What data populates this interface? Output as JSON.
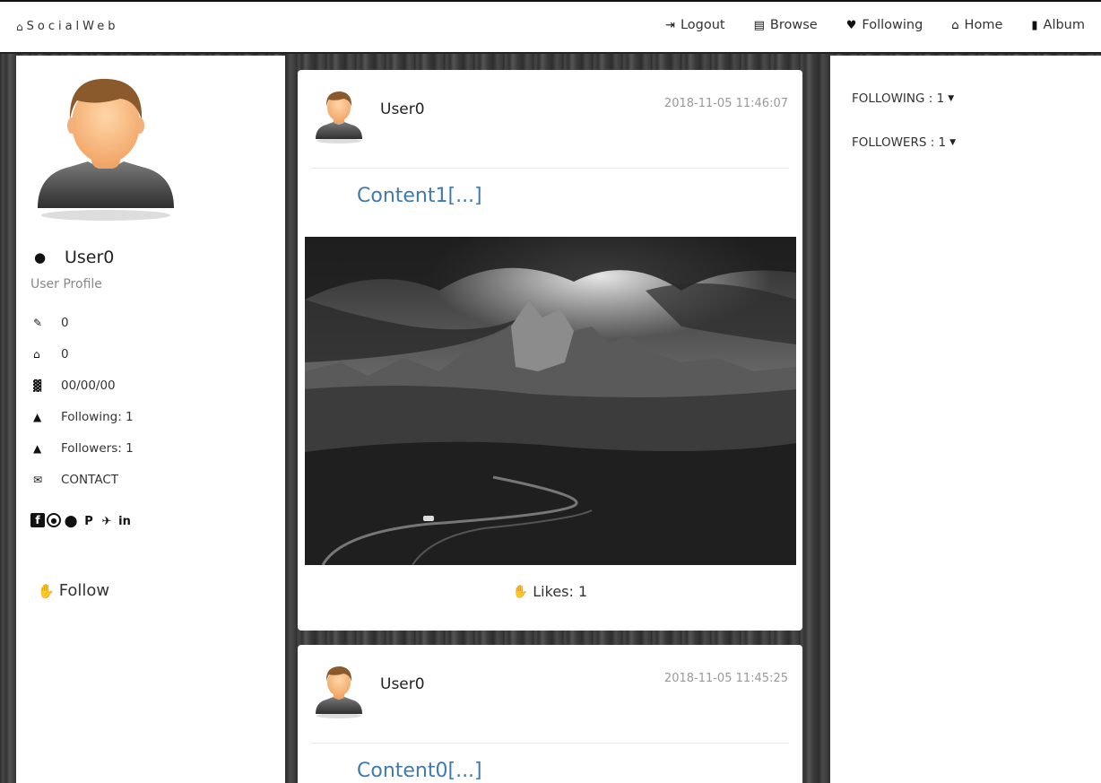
{
  "navbar": {
    "brand": "SocialWeb",
    "brand_icon": "home-icon",
    "items": [
      {
        "label": "Logout",
        "icon": "sign-in-icon"
      },
      {
        "label": "Browse",
        "icon": "list-icon"
      },
      {
        "label": "Following",
        "icon": "heart-icon"
      },
      {
        "label": "Home",
        "icon": "home-icon"
      },
      {
        "label": "Album",
        "icon": "book-icon"
      }
    ]
  },
  "profile": {
    "name": "User0",
    "subtitle": "User Profile",
    "info": [
      {
        "icon": "pencil-icon",
        "value": "0"
      },
      {
        "icon": "home-icon",
        "value": "0"
      },
      {
        "icon": "birthday-cake-icon",
        "value": "00/00/00"
      },
      {
        "icon": "user-icon",
        "value": "Following: 1"
      },
      {
        "icon": "user-icon",
        "value": "Followers: 1"
      },
      {
        "icon": "envelope-icon",
        "value": "CONTACT"
      }
    ],
    "socials": [
      "facebook-icon",
      "instagram-icon",
      "snapchat-icon",
      "pinterest-icon",
      "twitter-icon",
      "linkedin-icon"
    ],
    "follow_label": "Follow"
  },
  "posts": [
    {
      "user": "User0",
      "time": "2018-11-05 11:46:07",
      "content": "Content1[...]",
      "likes": "Likes: 1",
      "has_image": true
    },
    {
      "user": "User0",
      "time": "2018-11-05 11:45:25",
      "content": "Content0[...]"
    }
  ],
  "sidebar_right": {
    "following": "FOLLOWING : 1",
    "followers": "FOLLOWERS : 1"
  }
}
